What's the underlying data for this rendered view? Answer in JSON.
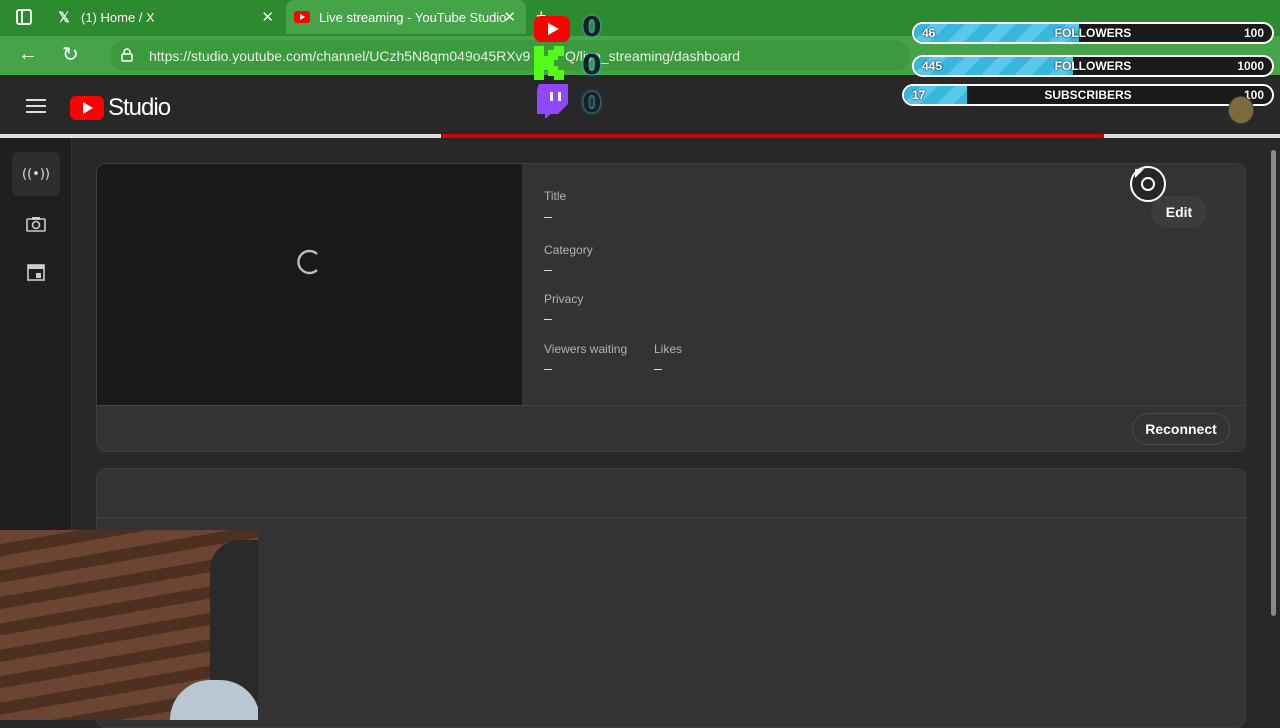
{
  "browser": {
    "tabs": [
      {
        "title": "(1) Home / X",
        "icon": "x-logo-icon"
      },
      {
        "title": "Live streaming - YouTube Studio",
        "icon": "youtube-icon"
      }
    ],
    "url": "https://studio.youtube.com/channel/UCzh5N8qm049o45RXv9",
    "url_tail": "Q/live_streaming/dashboard"
  },
  "header": {
    "logo_text": "Studio"
  },
  "sidebar": {
    "items": [
      {
        "icon": "live-broadcast-icon"
      },
      {
        "icon": "camera-icon"
      },
      {
        "icon": "calendar-icon"
      }
    ]
  },
  "stream": {
    "fields": [
      {
        "label": "Title",
        "value": "–"
      },
      {
        "label": "Category",
        "value": "–"
      },
      {
        "label": "Privacy",
        "value": "–"
      },
      {
        "label": "Viewers waiting",
        "value": "–"
      },
      {
        "label": "Likes",
        "value": "–"
      }
    ],
    "edit_label": "Edit",
    "reconnect_label": "Reconnect"
  },
  "overlay": {
    "counters": [
      {
        "platform": "youtube",
        "value": "0"
      },
      {
        "platform": "kick",
        "value": "0"
      },
      {
        "platform": "twitch",
        "value": "0"
      }
    ],
    "goals": [
      {
        "current": "46",
        "label": "FOLLOWERS",
        "goal": "100",
        "progress": 0.46
      },
      {
        "current": "445",
        "label": "FOLLOWERS",
        "goal": "1000",
        "progress": 0.445
      },
      {
        "current": "17",
        "label": "SUBSCRIBERS",
        "goal": "100",
        "progress": 0.17
      }
    ]
  },
  "colors": {
    "chrome_green": "#44a447",
    "youtube_red": "#ff0000",
    "progress_red": "#cc0000",
    "goal_blue": "#37b6de"
  }
}
